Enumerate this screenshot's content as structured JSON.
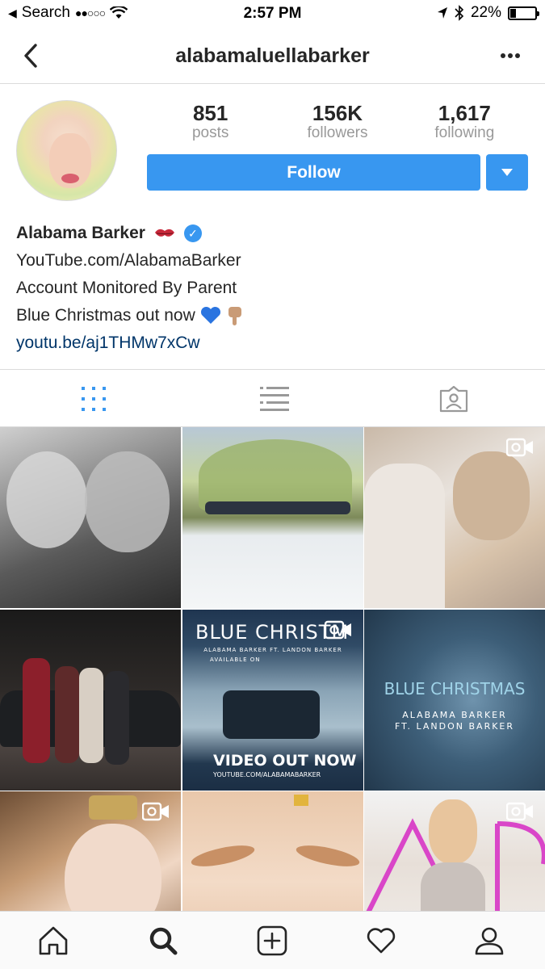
{
  "status_bar": {
    "carrier": "Search",
    "signal_dots": "●●○○○",
    "time": "2:57 PM",
    "battery": "22%",
    "battery_level": 0.22
  },
  "nav": {
    "title": "alabamaluellabarker"
  },
  "stats": [
    {
      "value": "851",
      "label": "posts"
    },
    {
      "value": "156K",
      "label": "followers"
    },
    {
      "value": "1,617",
      "label": "following"
    }
  ],
  "follow_label": "Follow",
  "bio": {
    "name": "Alabama Barker",
    "line1": "YouTube.com/AlabamaBarker",
    "line2": "Account Monitored By Parent",
    "line3": "Blue Christmas out now",
    "link": "youtu.be/aj1THMw7xCw"
  },
  "grid": {
    "post5_title": "BLUE CHRISTM",
    "post5_subtitle": "ALABAMA BARKER FT. LANDON BARKER",
    "post5_available": "AVAILABLE ON",
    "post5_cta": "VIDEO OUT NOW",
    "post5_url": "YOUTUBE.COM/ALABAMABARKER",
    "post6_title": "BLUE CHRISTMAS",
    "post6_line1": "ALABAMA BARKER",
    "post6_line2": "FT. LANDON BARKER"
  },
  "colors": {
    "accent": "#3897f0",
    "link": "#003569",
    "muted": "#999999"
  }
}
